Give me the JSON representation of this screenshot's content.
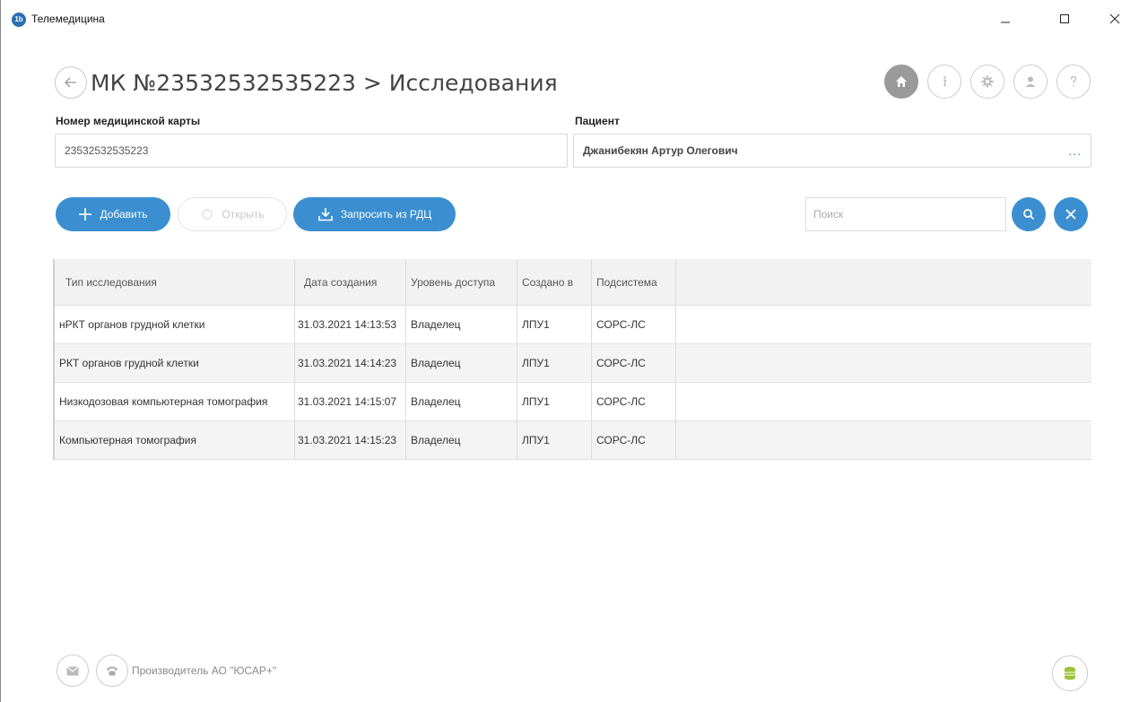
{
  "window": {
    "title": "Телемедицина",
    "logo_text": "1b"
  },
  "header": {
    "title": "МК №23532532535223 > Исследования"
  },
  "form": {
    "card_label": "Номер медицинской карты",
    "card_value": "23532532535223",
    "patient_label": "Пациент",
    "patient_value": "Джанибекян  Артур  Олегович",
    "patient_more": "..."
  },
  "toolbar": {
    "add_label": "Добавить",
    "open_label": "Открыть",
    "request_label": "Запросить из РДЦ",
    "search_placeholder": "Поиск"
  },
  "table": {
    "columns": [
      "Тип исследования",
      "Дата создания",
      "Уровень доступа",
      "Создано в",
      "Подсистема"
    ],
    "rows": [
      [
        "нРКТ органов грудной клетки",
        "31.03.2021 14:13:53",
        "Владелец",
        "ЛПУ1",
        "СОРС-ЛС"
      ],
      [
        "РКТ органов грудной клетки",
        "31.03.2021 14:14:23",
        "Владелец",
        "ЛПУ1",
        "СОРС-ЛС"
      ],
      [
        "Низкодозовая компьютерная томография",
        "31.03.2021 14:15:07",
        "Владелец",
        "ЛПУ1",
        "СОРС-ЛС"
      ],
      [
        "Компьютерная томография",
        "31.03.2021 14:15:23",
        "Владелец",
        "ЛПУ1",
        "СОРС-ЛС"
      ]
    ]
  },
  "footer": {
    "manufacturer": "Производитель АО \"ЮСАР+\""
  },
  "colors": {
    "accent": "#3b8fd0",
    "active_icon": "#9a9a9a",
    "status_green": "#9bc43a"
  }
}
